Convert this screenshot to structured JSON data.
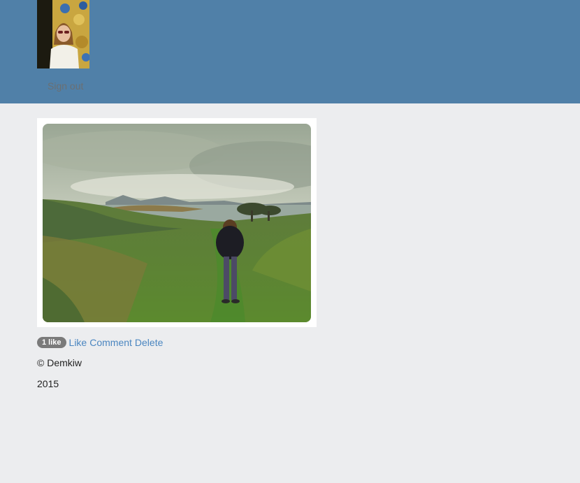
{
  "header": {
    "signout_label": "Sign out",
    "background_color": "#5080a8"
  },
  "avatar": {
    "icon": "user-avatar-photo"
  },
  "post": {
    "photo_icon": "landscape-photo",
    "likes_badge": "1 like",
    "actions": {
      "like_label": "Like",
      "comment_label": "Comment",
      "delete_label": "Delete"
    },
    "copyright": "© Demkiw",
    "year": "2015"
  },
  "colors": {
    "page_background": "#ecedef",
    "link": "#4b86c0",
    "badge": "#7a7a7a"
  }
}
